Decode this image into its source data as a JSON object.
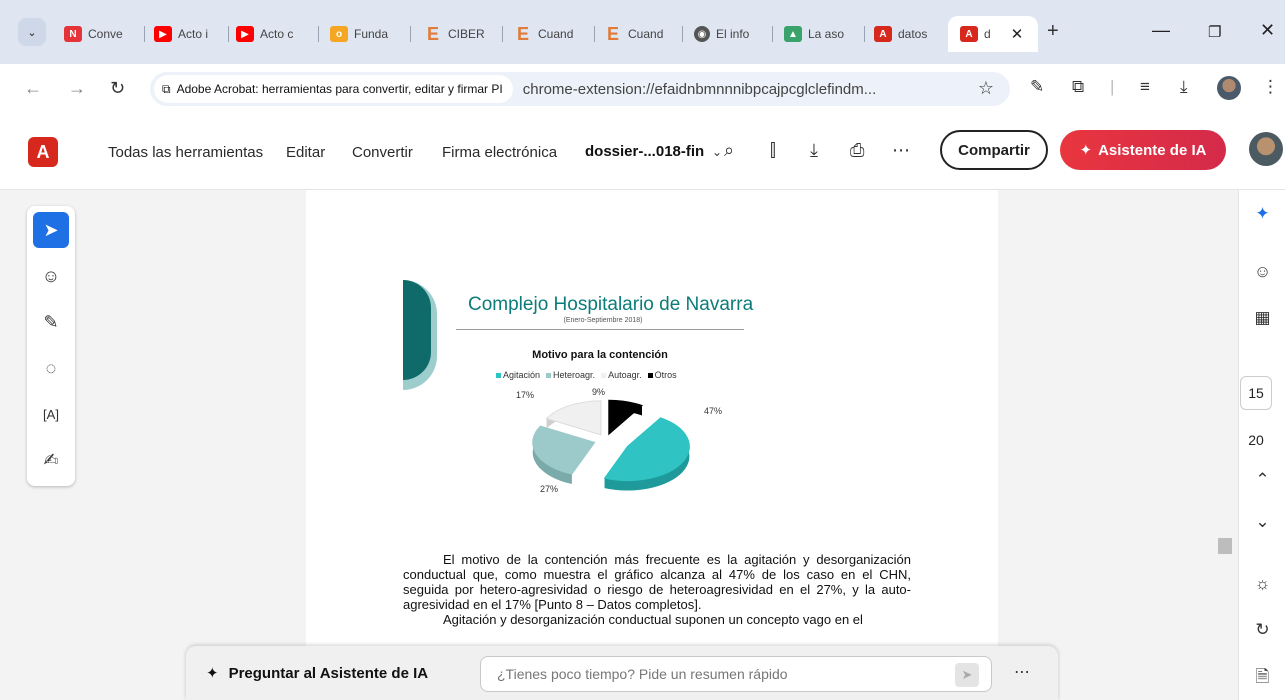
{
  "browser": {
    "tabs": [
      {
        "label": "Conve",
        "icon": "nitro-icon",
        "color": "#e44"
      },
      {
        "label": "Acto i",
        "icon": "youtube-icon",
        "color": "#f00"
      },
      {
        "label": "Acto c",
        "icon": "youtube-icon",
        "color": "#f00"
      },
      {
        "label": "Funda",
        "icon": "colorful-icon",
        "color": "#f90"
      },
      {
        "label": "CIBER",
        "icon": "e-icon",
        "color": "#e07b39"
      },
      {
        "label": "Cuand",
        "icon": "e-icon",
        "color": "#e07b39"
      },
      {
        "label": "Cuand",
        "icon": "e-icon",
        "color": "#e07b39"
      },
      {
        "label": "El info",
        "icon": "globe-icon",
        "color": "#555"
      },
      {
        "label": "La aso",
        "icon": "image-icon",
        "color": "#3a7"
      },
      {
        "label": "datos",
        "icon": "acrobat-icon",
        "color": "#d7281e"
      }
    ],
    "active_tab": {
      "label": "d",
      "icon": "acrobat-icon"
    },
    "address": {
      "site_chip": "Adobe Acrobat: herramientas para convertir, editar y firmar PI",
      "url": "chrome-extension://efaidnbmnnnibpcajpcglclefindm..."
    }
  },
  "acrobat": {
    "menu": [
      "Todas las herramientas",
      "Editar",
      "Convertir",
      "Firma electrónica"
    ],
    "doc_name": "dossier-...018-fin",
    "share_label": "Compartir",
    "ai_label": "Asistente de IA"
  },
  "document": {
    "slide_title": "Complejo Hospitalario de Navarra",
    "slide_subtitle": "(Enero-Septiembre 2018)",
    "chart_title": "Motivo para la contención",
    "label_17": "17%",
    "label_9": "9%",
    "label_47": "47%",
    "label_27": "27%",
    "paragraph1": "El motivo de la contención más frecuente es la agitación y desorganización conductual que, como muestra el gráfico alcanza al 47% de los caso en el CHN, seguida por hetero-agresividad o riesgo de heteroagresividad en el 27%, y la auto-agresividad en el 17% [Punto 8 – Datos completos].",
    "paragraph2": "Agitación y desorganización conductual suponen un concepto vago en el"
  },
  "chart_data": {
    "type": "pie",
    "title": "Motivo para la contención",
    "legend": [
      {
        "name": "Agitación",
        "color": "#2fc3c3"
      },
      {
        "name": "Heteroagr.",
        "color": "#9ccaca"
      },
      {
        "name": "Autoagr.",
        "color": "#f0f0f0"
      },
      {
        "name": "Otros",
        "color": "#000000"
      }
    ],
    "categories": [
      "Agitación",
      "Heteroagr.",
      "Autoagr.",
      "Otros"
    ],
    "values": [
      47,
      27,
      17,
      9
    ],
    "legend_position": "top"
  },
  "viewer": {
    "page_current": "15",
    "page_total": "20"
  },
  "ai_bar": {
    "label": "Preguntar al Asistente de IA",
    "placeholder": "¿Tienes poco tiempo? Pide un resumen rápido"
  }
}
